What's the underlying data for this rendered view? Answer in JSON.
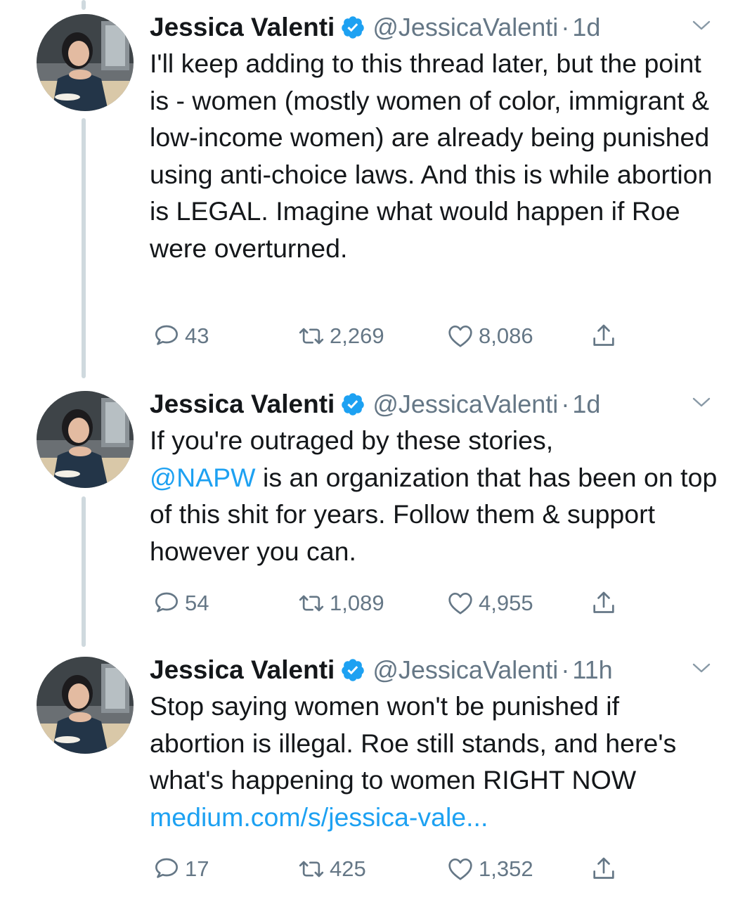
{
  "tweets": [
    {
      "name": "Jessica Valenti",
      "handle": "@JessicaValenti",
      "time": "1d",
      "text": "I'll keep adding to this thread later, but the point is - women (mostly women of color, immigrant & low-income women) are already being punished using anti-choice laws. And this is while abortion is LEGAL. Imagine what would happen if Roe were overturned.",
      "replies": "43",
      "retweets": "2,269",
      "likes": "8,086"
    },
    {
      "name": "Jessica Valenti",
      "handle": "@JessicaValenti",
      "time": "1d",
      "text_before": "If you're outraged by these stories,\n",
      "mention": "@NAPW",
      "text_after": " is an organization that has been on top of this shit for years. Follow them & support however you can.",
      "replies": "54",
      "retweets": "1,089",
      "likes": "4,955"
    },
    {
      "name": "Jessica Valenti",
      "handle": "@JessicaValenti",
      "time": "11h",
      "text_before": "Stop saying women won't be punished if abortion is illegal. Roe still stands, and here's what's happening to women RIGHT NOW ",
      "link": "medium.com/s/jessica-vale...",
      "replies": "17",
      "retweets": "425",
      "likes": "1,352"
    }
  ],
  "separator": "·",
  "icons": {
    "verified": "verified-badge-icon",
    "caret": "chevron-down-icon",
    "reply": "reply-icon",
    "retweet": "retweet-icon",
    "like": "heart-icon",
    "share": "share-icon"
  },
  "colors": {
    "text": "#14171a",
    "secondary": "#657786",
    "link": "#1da1f2",
    "thread_line": "#cfd9de"
  }
}
